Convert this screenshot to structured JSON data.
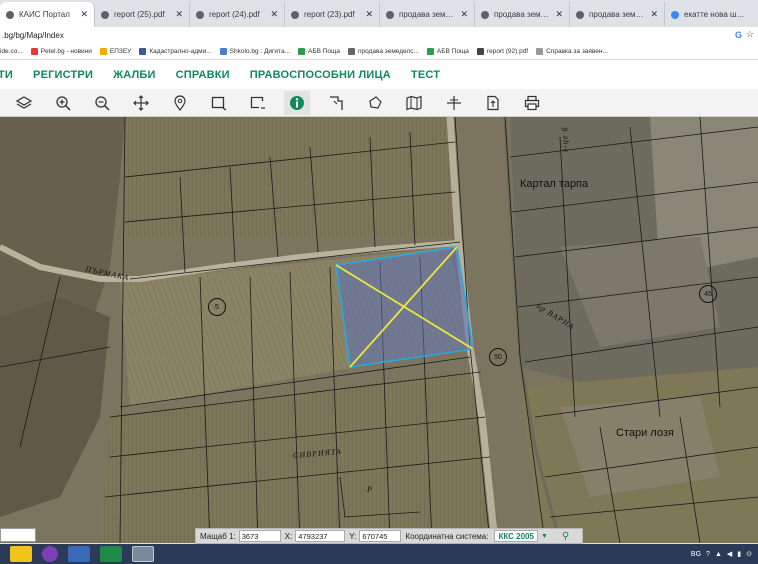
{
  "tabs": [
    {
      "title": "КАИС Портал",
      "active": true
    },
    {
      "title": "report (25).pdf",
      "active": false
    },
    {
      "title": "report (24).pdf",
      "active": false
    },
    {
      "title": "report (23).pdf",
      "active": false
    },
    {
      "title": "продава земеделска",
      "active": false
    },
    {
      "title": "продава земеделска",
      "active": false
    },
    {
      "title": "продава земеделска",
      "active": false
    },
    {
      "title": "екатте нова шипка - ",
      "active": false
    }
  ],
  "url": ".bg/bg/Map/Index",
  "bookmarks": [
    "ide.co...",
    "Petel.bg - новини",
    "ЕПЗЕУ",
    "Кадастрално-адми...",
    "Shkolo.bg : Дигита...",
    "АБВ Поща",
    "продава земеделс...",
    "АБВ Поща",
    "report (92).pdf",
    "Справка за заявен..."
  ],
  "menu": [
    "ТИ",
    "РЕГИСТРИ",
    "ЖАЛБИ",
    "СПРАВКИ",
    "ПРАВОСПОСОБНИ ЛИЦА",
    "ТЕСТ"
  ],
  "toolbar": [
    {
      "icon": "layers-icon"
    },
    {
      "icon": "zoom-in-icon"
    },
    {
      "icon": "zoom-out-icon"
    },
    {
      "icon": "pan-icon"
    },
    {
      "icon": "marker-icon"
    },
    {
      "icon": "select-rect-icon"
    },
    {
      "icon": "select-rect-alt-icon"
    },
    {
      "icon": "info-icon"
    },
    {
      "icon": "measure-icon"
    },
    {
      "icon": "polygon-icon"
    },
    {
      "icon": "map-icon"
    },
    {
      "icon": "crosshair-icon"
    },
    {
      "icon": "export-icon"
    },
    {
      "icon": "print-icon"
    }
  ],
  "map": {
    "labels": {
      "kartal": "Картал тарпа",
      "stari": "Стари лозя",
      "sivria": "СИВРИЯТА",
      "varna": "пр ВАРНА",
      "parmaka": "ПЪРМАКА",
      "road_top": "э-це б",
      "letter_p": "Р"
    },
    "parcel_numbers": [
      "5",
      "45",
      "50"
    ]
  },
  "status": {
    "scale_label": "Мащаб 1:",
    "scale_value": "3673",
    "x_label": "X:",
    "x_value": "4793237",
    "y_label": "Y:",
    "y_value": "670745",
    "crs_label": "Координатна система:",
    "crs_value": "ККС 2005"
  },
  "tray": {
    "lang": "BG"
  },
  "colors": {
    "accent": "#13885b",
    "parcel_outline": "#2aa9e0",
    "diagonal": "#e8e83a"
  }
}
